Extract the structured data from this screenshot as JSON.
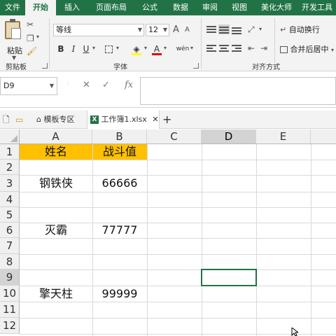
{
  "ribbon_tabs": [
    "文件",
    "开始",
    "插入",
    "页面布局",
    "公式",
    "数据",
    "审阅",
    "视图",
    "美化大师",
    "开发工具"
  ],
  "ribbon_active_tab": "开始",
  "clipboard": {
    "paste_label": "粘贴",
    "group_label": "剪贴板"
  },
  "font": {
    "name": "等线",
    "size": "12",
    "group_label": "字体",
    "bold": "B",
    "italic": "I",
    "underline": "U",
    "grow": "A",
    "shrink": "A",
    "font_color": "A",
    "phonetic": "wén"
  },
  "alignment": {
    "wrap_text": "自动换行",
    "merge_center": "合并后居中",
    "group_label": "对齐方式"
  },
  "formula_bar": {
    "name_box": "D9",
    "cancel": "✕",
    "enter": "✓",
    "fx": "fx",
    "formula": ""
  },
  "workbook_tabs": {
    "template": "模板专区",
    "file": "工作簿1.xlsx",
    "close": "✕",
    "add": "+"
  },
  "grid": {
    "columns": [
      "A",
      "B",
      "C",
      "D",
      "E"
    ],
    "rows": [
      "1",
      "2",
      "3",
      "4",
      "5",
      "6",
      "7",
      "8",
      "9",
      "10",
      "11",
      "12"
    ],
    "header_fill": "#ffc000",
    "cells": {
      "A1": "姓名",
      "B1": "战斗值",
      "A3": "钢铁侠",
      "B3": "66666",
      "A6": "灭霸",
      "B6": "77777",
      "A10": "擎天柱",
      "B10": "99999"
    },
    "selected_cell": "D9"
  },
  "colors": {
    "accent": "#217346",
    "header_fill": "#ffc000"
  }
}
